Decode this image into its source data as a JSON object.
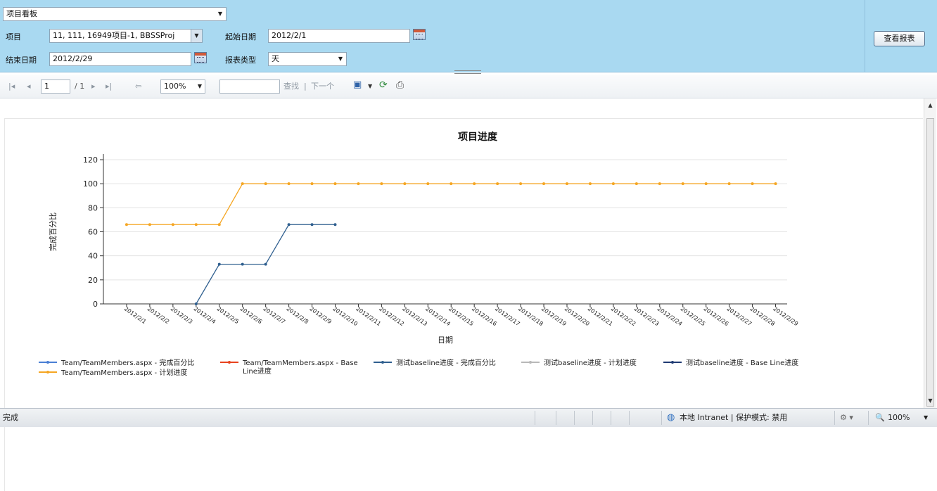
{
  "parameters": {
    "report_select": "项目看板",
    "project_label": "项目",
    "project_value": "11, 111, 16949项目-1, BBSSProj",
    "start_label": "起始日期",
    "start_value": "2012/2/1",
    "end_label": "结束日期",
    "end_value": "2012/2/29",
    "type_label": "报表类型",
    "type_value": "天",
    "view_button": "查看报表"
  },
  "toolbar": {
    "page_current": "1",
    "page_total": "/ 1",
    "zoom": "100%",
    "find_label": "查找",
    "separator": "|",
    "next_label": "下一个",
    "find_value": ""
  },
  "chart_data": {
    "type": "line",
    "title": "项目进度",
    "xlabel": "日期",
    "ylabel": "完成百分比",
    "ylim": [
      0,
      120
    ],
    "yticks": [
      0,
      20,
      40,
      60,
      80,
      100,
      120
    ],
    "grid": true,
    "legend_position": "bottom",
    "categories": [
      "2012/2/1",
      "2012/2/2",
      "2012/2/3",
      "2012/2/4",
      "2012/2/5",
      "2012/2/6",
      "2012/2/7",
      "2012/2/8",
      "2012/2/9",
      "2012/2/10",
      "2012/2/11",
      "2012/2/12",
      "2012/2/13",
      "2012/2/14",
      "2012/2/15",
      "2012/2/16",
      "2012/2/17",
      "2012/2/18",
      "2012/2/19",
      "2012/2/20",
      "2012/2/21",
      "2012/2/22",
      "2012/2/23",
      "2012/2/24",
      "2012/2/25",
      "2012/2/26",
      "2012/2/27",
      "2012/2/28",
      "2012/2/29"
    ],
    "series": [
      {
        "name": "Team/TeamMembers.aspx - 完成百分比",
        "color": "#4a7fd4",
        "values": []
      },
      {
        "name": "Team/TeamMembers.aspx - 计划进度",
        "color": "#f5a623",
        "values": [
          66,
          66,
          66,
          66,
          66,
          100,
          100,
          100,
          100,
          100,
          100,
          100,
          100,
          100,
          100,
          100,
          100,
          100,
          100,
          100,
          100,
          100,
          100,
          100,
          100,
          100,
          100,
          100,
          100
        ]
      },
      {
        "name": "Team/TeamMembers.aspx - Base Line进度",
        "color": "#e8431e",
        "values": []
      },
      {
        "name": "测试baseline进度 - 完成百分比",
        "color": "#2f5f8f",
        "values": [
          null,
          null,
          null,
          0,
          33,
          33,
          33,
          66,
          66,
          66
        ]
      },
      {
        "name": "测试baseline进度 - 计划进度",
        "color": "#b8b8b8",
        "values": []
      },
      {
        "name": "测试baseline进度 - Base Line进度",
        "color": "#1f3a73",
        "values": []
      }
    ]
  },
  "statusbar": {
    "status_text": "完成",
    "zone_text": "本地 Intranet | 保护模式: 禁用",
    "zoom_text": "100%"
  },
  "icons": {
    "first_page": "first-page-icon",
    "prev_page": "prev-page-icon",
    "next_page": "next-page-icon",
    "last_page": "last-page-icon",
    "back": "back-icon",
    "export": "save-icon",
    "refresh": "refresh-icon",
    "print": "print-icon",
    "calendar": "calendar-icon"
  }
}
